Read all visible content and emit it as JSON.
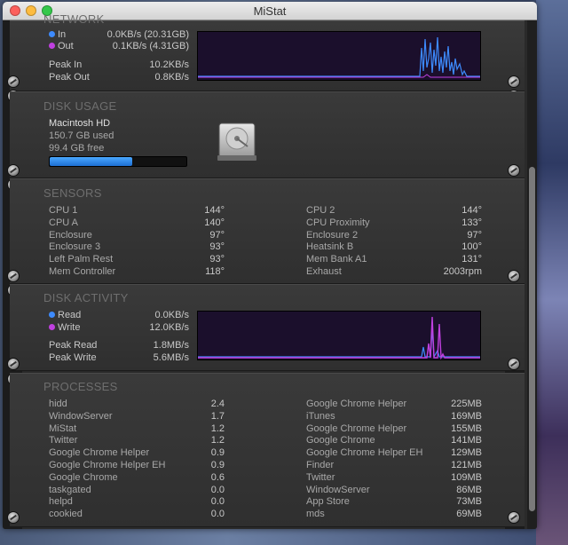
{
  "window": {
    "title": "MiStat"
  },
  "network": {
    "title": "NETWORK",
    "in_label": "In",
    "in_value": "0.0KB/s (20.31GB)",
    "out_label": "Out",
    "out_value": "0.1KB/s (4.31GB)",
    "peak_in_label": "Peak In",
    "peak_in_value": "10.2KB/s",
    "peak_out_label": "Peak Out",
    "peak_out_value": "0.8KB/s",
    "in_color": "#3d8bff",
    "out_color": "#c040e0"
  },
  "disk_usage": {
    "title": "DISK USAGE",
    "volume": "Macintosh HD",
    "used": "150.7 GB used",
    "free": "99.4 GB free",
    "used_fraction": 0.6026,
    "drive_icon": "hard-drive-icon"
  },
  "sensors": {
    "title": "SENSORS",
    "left": [
      {
        "name": "CPU 1",
        "value": "144°"
      },
      {
        "name": "CPU A",
        "value": "140°"
      },
      {
        "name": "Enclosure",
        "value": "97°"
      },
      {
        "name": "Enclosure 3",
        "value": "93°"
      },
      {
        "name": "Left Palm Rest",
        "value": "93°"
      },
      {
        "name": "Mem Controller",
        "value": "118°"
      }
    ],
    "right": [
      {
        "name": "CPU 2",
        "value": "144°"
      },
      {
        "name": "CPU Proximity",
        "value": "133°"
      },
      {
        "name": "Enclosure 2",
        "value": "97°"
      },
      {
        "name": "Heatsink B",
        "value": "100°"
      },
      {
        "name": "Mem Bank A1",
        "value": "131°"
      },
      {
        "name": "Exhaust",
        "value": "2003rpm"
      }
    ]
  },
  "disk_activity": {
    "title": "DISK ACTIVITY",
    "read_label": "Read",
    "read_value": "0.0KB/s",
    "write_label": "Write",
    "write_value": "12.0KB/s",
    "peak_read_label": "Peak Read",
    "peak_read_value": "1.8MB/s",
    "peak_write_label": "Peak Write",
    "peak_write_value": "5.6MB/s"
  },
  "processes": {
    "title": "PROCESSES",
    "cpu": [
      {
        "name": "hidd",
        "value": "2.4"
      },
      {
        "name": "WindowServer",
        "value": "1.7"
      },
      {
        "name": "MiStat",
        "value": "1.2"
      },
      {
        "name": "Twitter",
        "value": "1.2"
      },
      {
        "name": "Google Chrome Helper",
        "value": "0.9"
      },
      {
        "name": "Google Chrome Helper EH",
        "value": "0.9"
      },
      {
        "name": "Google Chrome",
        "value": "0.6"
      },
      {
        "name": "taskgated",
        "value": "0.0"
      },
      {
        "name": "helpd",
        "value": "0.0"
      },
      {
        "name": "cookied",
        "value": "0.0"
      }
    ],
    "memory": [
      {
        "name": "Google Chrome Helper",
        "value": "225MB"
      },
      {
        "name": "iTunes",
        "value": "169MB"
      },
      {
        "name": "Google Chrome Helper",
        "value": "155MB"
      },
      {
        "name": "Google Chrome",
        "value": "141MB"
      },
      {
        "name": "Google Chrome Helper EH",
        "value": "129MB"
      },
      {
        "name": "Finder",
        "value": "121MB"
      },
      {
        "name": "Twitter",
        "value": "109MB"
      },
      {
        "name": "WindowServer",
        "value": "86MB"
      },
      {
        "name": "App Store",
        "value": "73MB"
      },
      {
        "name": "mds",
        "value": "69MB"
      }
    ]
  }
}
